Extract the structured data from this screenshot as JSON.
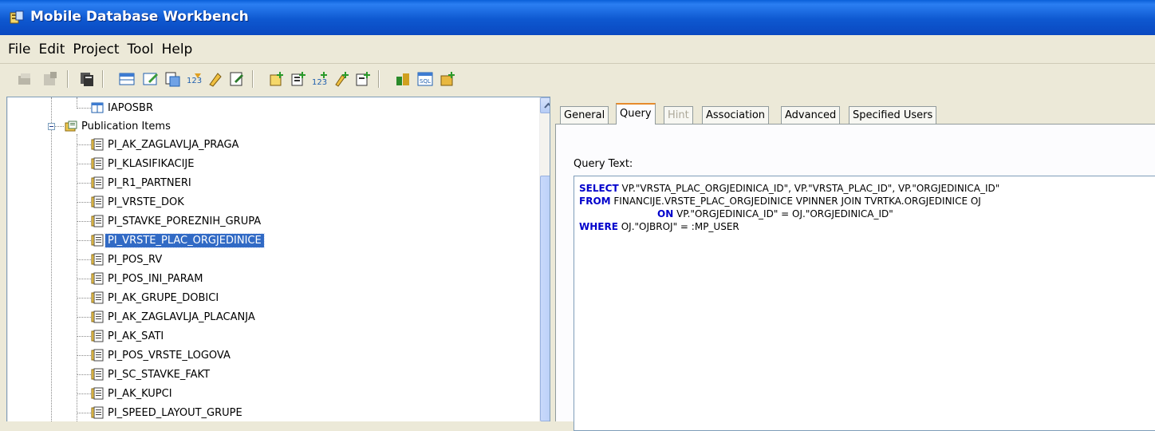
{
  "window": {
    "title": "Mobile Database Workbench"
  },
  "menu": [
    "File",
    "Edit",
    "Project",
    "Tool",
    "Help"
  ],
  "toolbar": {
    "buttons": [
      "open-icon",
      "properties-icon",
      "copy-icon",
      "table-icon",
      "edit-table-icon",
      "snapshot-icon",
      "sequence-icon",
      "script-icon",
      "properties2-icon",
      "add-item-icon",
      "add-snapshot-icon",
      "add-sequence-icon",
      "add-script-icon",
      "add-field-icon",
      "deploy-icon",
      "sql-icon",
      "package-icon"
    ]
  },
  "tree": {
    "top_item": "IAPOSBR",
    "folder": "Publication Items",
    "items": [
      "PI_AK_ZAGLAVLJA_PRAGA",
      "PI_KLASIFIKACIJE",
      "PI_R1_PARTNERI",
      "PI_VRSTE_DOK",
      "PI_STAVKE_POREZNIH_GRUPA",
      "PI_VRSTE_PLAC_ORGJEDINICE",
      "PI_POS_RV",
      "PI_POS_INI_PARAM",
      "PI_AK_GRUPE_DOBICI",
      "PI_AK_ZAGLAVLJA_PLACANJA",
      "PI_AK_SATI",
      "PI_POS_VRSTE_LOGOVA",
      "PI_SC_STAVKE_FAKT",
      "PI_AK_KUPCI",
      "PI_SPEED_LAYOUT_GRUPE"
    ],
    "selected": "PI_VRSTE_PLAC_ORGJEDINICE"
  },
  "tabs": [
    "General",
    "Query",
    "Hint",
    "Association",
    "Advanced",
    "Specified Users"
  ],
  "active_tab": "Query",
  "disabled_tab": "Hint",
  "query": {
    "label": "Query Text:",
    "lines": [
      {
        "kw": "SELECT",
        "text": " VP.\"VRSTA_PLAC_ORGJEDINICA_ID\", VP.\"VRSTA_PLAC_ID\", VP.\"ORGJEDINICA_ID\""
      },
      {
        "kw": "FROM",
        "text": " FINANCIJE.VRSTE_PLAC_ORGJEDINICE VPINNER JOIN TVRTKA.ORGJEDINICE OJ"
      },
      {
        "kw": "ON",
        "text": " VP.\"ORGJEDINICA_ID\" = OJ.\"ORGJEDINICA_ID\""
      },
      {
        "kw": "WHERE",
        "text": " OJ.\"OJBROJ\" = :MP_USER"
      }
    ]
  },
  "colors": {
    "title_bar": "#0a58d0",
    "selection": "#316ac5",
    "keyword": "#0000cc",
    "active_tab_accent": "#e68b2c"
  }
}
